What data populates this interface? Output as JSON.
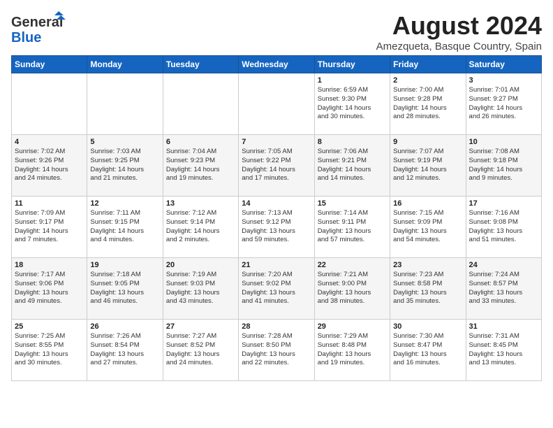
{
  "header": {
    "logo_general": "General",
    "logo_blue": "Blue",
    "month": "August 2024",
    "location": "Amezqueta, Basque Country, Spain"
  },
  "weekdays": [
    "Sunday",
    "Monday",
    "Tuesday",
    "Wednesday",
    "Thursday",
    "Friday",
    "Saturday"
  ],
  "weeks": [
    [
      {
        "day": "",
        "info": ""
      },
      {
        "day": "",
        "info": ""
      },
      {
        "day": "",
        "info": ""
      },
      {
        "day": "",
        "info": ""
      },
      {
        "day": "1",
        "info": "Sunrise: 6:59 AM\nSunset: 9:30 PM\nDaylight: 14 hours\nand 30 minutes."
      },
      {
        "day": "2",
        "info": "Sunrise: 7:00 AM\nSunset: 9:28 PM\nDaylight: 14 hours\nand 28 minutes."
      },
      {
        "day": "3",
        "info": "Sunrise: 7:01 AM\nSunset: 9:27 PM\nDaylight: 14 hours\nand 26 minutes."
      }
    ],
    [
      {
        "day": "4",
        "info": "Sunrise: 7:02 AM\nSunset: 9:26 PM\nDaylight: 14 hours\nand 24 minutes."
      },
      {
        "day": "5",
        "info": "Sunrise: 7:03 AM\nSunset: 9:25 PM\nDaylight: 14 hours\nand 21 minutes."
      },
      {
        "day": "6",
        "info": "Sunrise: 7:04 AM\nSunset: 9:23 PM\nDaylight: 14 hours\nand 19 minutes."
      },
      {
        "day": "7",
        "info": "Sunrise: 7:05 AM\nSunset: 9:22 PM\nDaylight: 14 hours\nand 17 minutes."
      },
      {
        "day": "8",
        "info": "Sunrise: 7:06 AM\nSunset: 9:21 PM\nDaylight: 14 hours\nand 14 minutes."
      },
      {
        "day": "9",
        "info": "Sunrise: 7:07 AM\nSunset: 9:19 PM\nDaylight: 14 hours\nand 12 minutes."
      },
      {
        "day": "10",
        "info": "Sunrise: 7:08 AM\nSunset: 9:18 PM\nDaylight: 14 hours\nand 9 minutes."
      }
    ],
    [
      {
        "day": "11",
        "info": "Sunrise: 7:09 AM\nSunset: 9:17 PM\nDaylight: 14 hours\nand 7 minutes."
      },
      {
        "day": "12",
        "info": "Sunrise: 7:11 AM\nSunset: 9:15 PM\nDaylight: 14 hours\nand 4 minutes."
      },
      {
        "day": "13",
        "info": "Sunrise: 7:12 AM\nSunset: 9:14 PM\nDaylight: 14 hours\nand 2 minutes."
      },
      {
        "day": "14",
        "info": "Sunrise: 7:13 AM\nSunset: 9:12 PM\nDaylight: 13 hours\nand 59 minutes."
      },
      {
        "day": "15",
        "info": "Sunrise: 7:14 AM\nSunset: 9:11 PM\nDaylight: 13 hours\nand 57 minutes."
      },
      {
        "day": "16",
        "info": "Sunrise: 7:15 AM\nSunset: 9:09 PM\nDaylight: 13 hours\nand 54 minutes."
      },
      {
        "day": "17",
        "info": "Sunrise: 7:16 AM\nSunset: 9:08 PM\nDaylight: 13 hours\nand 51 minutes."
      }
    ],
    [
      {
        "day": "18",
        "info": "Sunrise: 7:17 AM\nSunset: 9:06 PM\nDaylight: 13 hours\nand 49 minutes."
      },
      {
        "day": "19",
        "info": "Sunrise: 7:18 AM\nSunset: 9:05 PM\nDaylight: 13 hours\nand 46 minutes."
      },
      {
        "day": "20",
        "info": "Sunrise: 7:19 AM\nSunset: 9:03 PM\nDaylight: 13 hours\nand 43 minutes."
      },
      {
        "day": "21",
        "info": "Sunrise: 7:20 AM\nSunset: 9:02 PM\nDaylight: 13 hours\nand 41 minutes."
      },
      {
        "day": "22",
        "info": "Sunrise: 7:21 AM\nSunset: 9:00 PM\nDaylight: 13 hours\nand 38 minutes."
      },
      {
        "day": "23",
        "info": "Sunrise: 7:23 AM\nSunset: 8:58 PM\nDaylight: 13 hours\nand 35 minutes."
      },
      {
        "day": "24",
        "info": "Sunrise: 7:24 AM\nSunset: 8:57 PM\nDaylight: 13 hours\nand 33 minutes."
      }
    ],
    [
      {
        "day": "25",
        "info": "Sunrise: 7:25 AM\nSunset: 8:55 PM\nDaylight: 13 hours\nand 30 minutes."
      },
      {
        "day": "26",
        "info": "Sunrise: 7:26 AM\nSunset: 8:54 PM\nDaylight: 13 hours\nand 27 minutes."
      },
      {
        "day": "27",
        "info": "Sunrise: 7:27 AM\nSunset: 8:52 PM\nDaylight: 13 hours\nand 24 minutes."
      },
      {
        "day": "28",
        "info": "Sunrise: 7:28 AM\nSunset: 8:50 PM\nDaylight: 13 hours\nand 22 minutes."
      },
      {
        "day": "29",
        "info": "Sunrise: 7:29 AM\nSunset: 8:48 PM\nDaylight: 13 hours\nand 19 minutes."
      },
      {
        "day": "30",
        "info": "Sunrise: 7:30 AM\nSunset: 8:47 PM\nDaylight: 13 hours\nand 16 minutes."
      },
      {
        "day": "31",
        "info": "Sunrise: 7:31 AM\nSunset: 8:45 PM\nDaylight: 13 hours\nand 13 minutes."
      }
    ]
  ]
}
